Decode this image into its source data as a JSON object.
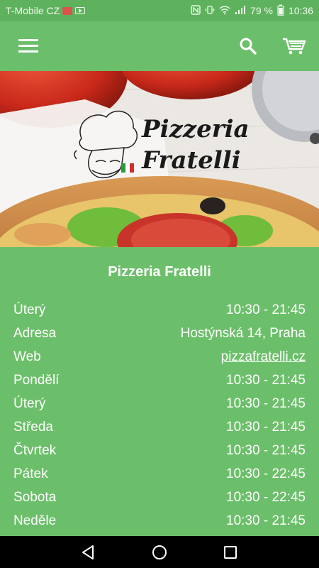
{
  "status_bar": {
    "carrier": "T-Mobile CZ",
    "battery": "79 %",
    "time": "10:36"
  },
  "app_bar": {
    "icons": [
      "menu-icon",
      "search-icon",
      "cart-icon"
    ]
  },
  "hero": {
    "logo_line1": "Pizzeria",
    "logo_line2": "Fratelli"
  },
  "info": {
    "title": "Pizzeria Fratelli",
    "rows": [
      {
        "label": "Úterý",
        "value": "10:30 - 21:45"
      },
      {
        "label": "Adresa",
        "value": "Hostýnská 14, Praha"
      },
      {
        "label": "Web",
        "value": "pizzafratelli.cz"
      },
      {
        "label": "Pondělí",
        "value": "10:30 - 21:45"
      },
      {
        "label": "Úterý",
        "value": "10:30 - 21:45"
      },
      {
        "label": "Středa",
        "value": "10:30 - 21:45"
      },
      {
        "label": "Čtvrtek",
        "value": "10:30 - 21:45"
      },
      {
        "label": "Pátek",
        "value": "10:30 - 22:45"
      },
      {
        "label": "Sobota",
        "value": "10:30 - 22:45"
      },
      {
        "label": "Neděle",
        "value": "10:30 - 21:45"
      }
    ]
  },
  "colors": {
    "primary": "#6cbf6a",
    "status_bar": "#5fb25d"
  }
}
